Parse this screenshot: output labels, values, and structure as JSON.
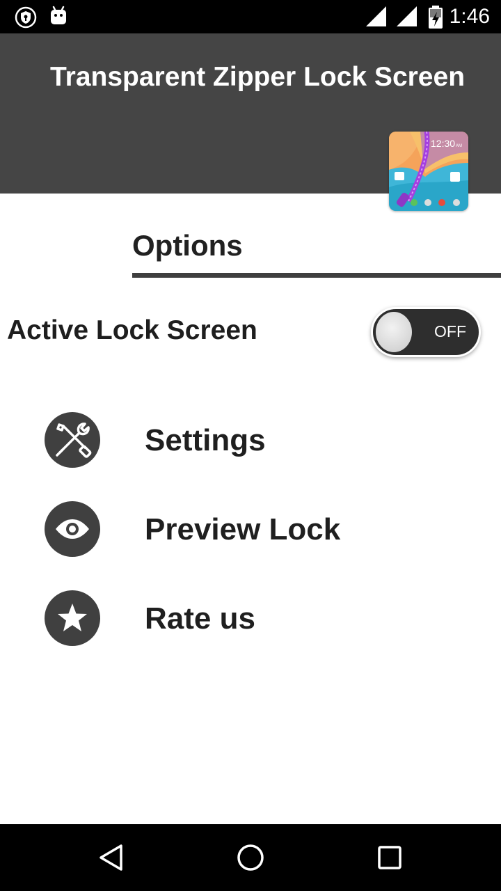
{
  "status_bar": {
    "time": "1:46",
    "icons": [
      "vpn-shield-icon",
      "android-debug-icon",
      "cell-signal-icon",
      "cell-signal-icon",
      "battery-charging-icon"
    ]
  },
  "header": {
    "title": "Transparent Zipper Lock Screen",
    "app_icon": {
      "icon": "zipper-lock-app-icon",
      "clock_text": "12:30",
      "clock_suffix": "AM"
    },
    "color": "#454545"
  },
  "options": {
    "heading": "Options"
  },
  "active_lock": {
    "label": "Active Lock Screen",
    "toggle_text": "OFF",
    "enabled": false
  },
  "menu": [
    {
      "id": "settings",
      "label": "Settings",
      "icon": "tools-icon"
    },
    {
      "id": "preview-lock",
      "label": "Preview Lock",
      "icon": "eye-icon"
    },
    {
      "id": "rate-us",
      "label": "Rate us",
      "icon": "star-icon"
    }
  ],
  "nav_bar": {
    "buttons": [
      "back-icon",
      "home-icon",
      "recents-icon"
    ]
  }
}
